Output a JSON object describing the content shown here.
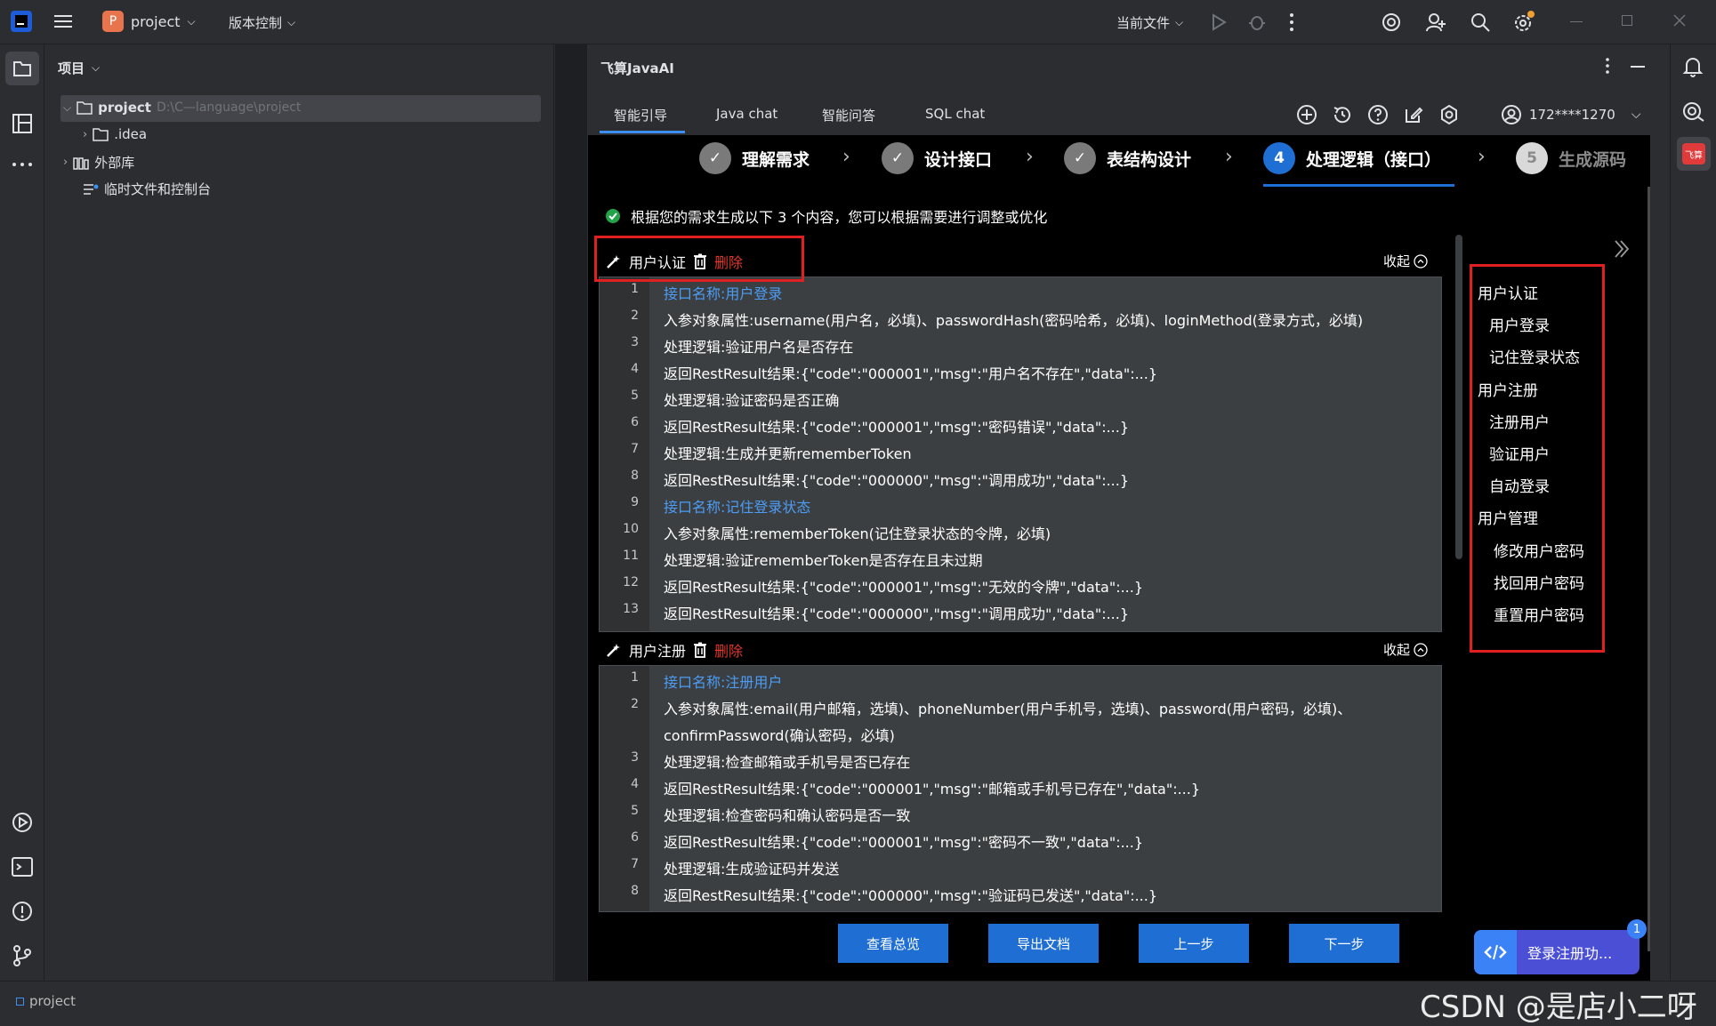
{
  "titlebar": {
    "project_badge": "P",
    "project_name": "project",
    "vcs_menu": "版本控制",
    "current_file": "当前文件"
  },
  "project_panel": {
    "title": "项目",
    "root_name": "project",
    "root_path": "D:\\C—language\\project",
    "items": [
      {
        "label": ".idea"
      },
      {
        "label": "外部库"
      },
      {
        "label": "临时文件和控制台"
      }
    ]
  },
  "plugin": {
    "title": "飞算JavaAI",
    "tabs": [
      "智能引导",
      "Java chat",
      "智能问答",
      "SQL chat"
    ],
    "active_tab": "智能引导",
    "account": "172****1270"
  },
  "steps": [
    {
      "label": "理解需求",
      "state": "done",
      "mark": "✓"
    },
    {
      "label": "设计接口",
      "state": "done",
      "mark": "✓"
    },
    {
      "label": "表结构设计",
      "state": "done",
      "mark": "✓"
    },
    {
      "label": "处理逻辑（接口）",
      "state": "active",
      "mark": "4"
    },
    {
      "label": "生成源码",
      "state": "pending",
      "mark": "5"
    }
  ],
  "info_message": "根据您的需求生成以下 3 个内容，您可以根据需要进行调整或优化",
  "sections": [
    {
      "name": "用户认证",
      "delete_label": "删除",
      "collapse_label": "收起",
      "lines": [
        {
          "n": "1",
          "text": "接口名称:用户登录",
          "type": "title"
        },
        {
          "n": "2",
          "text": "入参对象属性:username(用户名，必填)、passwordHash(密码哈希，必填)、loginMethod(登录方式，必填)",
          "type": "body"
        },
        {
          "n": "3",
          "text": "处理逻辑:验证用户名是否存在",
          "type": "body"
        },
        {
          "n": "4",
          "text": "返回RestResult结果:{\"code\":\"000001\",\"msg\":\"用户名不存在\",\"data\":...}",
          "type": "body"
        },
        {
          "n": "5",
          "text": "处理逻辑:验证密码是否正确",
          "type": "body"
        },
        {
          "n": "6",
          "text": "返回RestResult结果:{\"code\":\"000001\",\"msg\":\"密码错误\",\"data\":...}",
          "type": "body"
        },
        {
          "n": "7",
          "text": "处理逻辑:生成并更新rememberToken",
          "type": "body"
        },
        {
          "n": "8",
          "text": "返回RestResult结果:{\"code\":\"000000\",\"msg\":\"调用成功\",\"data\":...}",
          "type": "body"
        },
        {
          "n": "9",
          "text": "接口名称:记住登录状态",
          "type": "title"
        },
        {
          "n": "10",
          "text": "入参对象属性:rememberToken(记住登录状态的令牌，必填)",
          "type": "body"
        },
        {
          "n": "11",
          "text": "处理逻辑:验证rememberToken是否存在且未过期",
          "type": "body"
        },
        {
          "n": "12",
          "text": "返回RestResult结果:{\"code\":\"000001\",\"msg\":\"无效的令牌\",\"data\":...}",
          "type": "body"
        },
        {
          "n": "13",
          "text": "返回RestResult结果:{\"code\":\"000000\",\"msg\":\"调用成功\",\"data\":...}",
          "type": "body"
        }
      ]
    },
    {
      "name": "用户注册",
      "delete_label": "删除",
      "collapse_label": "收起",
      "lines": [
        {
          "n": "1",
          "text": "接口名称:注册用户",
          "type": "title"
        },
        {
          "n": "2",
          "text": "入参对象属性:email(用户邮箱，选填)、phoneNumber(用户手机号，选填)、password(用户密码，必填)、",
          "type": "body"
        },
        {
          "n": "",
          "text": "confirmPassword(确认密码，必填)",
          "type": "body"
        },
        {
          "n": "3",
          "text": "处理逻辑:检查邮箱或手机号是否已存在",
          "type": "body"
        },
        {
          "n": "4",
          "text": "返回RestResult结果:{\"code\":\"000001\",\"msg\":\"邮箱或手机号已存在\",\"data\":...}",
          "type": "body"
        },
        {
          "n": "5",
          "text": "处理逻辑:检查密码和确认密码是否一致",
          "type": "body"
        },
        {
          "n": "6",
          "text": "返回RestResult结果:{\"code\":\"000001\",\"msg\":\"密码不一致\",\"data\":...}",
          "type": "body"
        },
        {
          "n": "7",
          "text": "处理逻辑:生成验证码并发送",
          "type": "body"
        },
        {
          "n": "8",
          "text": "返回RestResult结果:{\"code\":\"000000\",\"msg\":\"验证码已发送\",\"data\":...}",
          "type": "body"
        }
      ]
    }
  ],
  "toc": [
    {
      "label": "用户认证",
      "level": 0
    },
    {
      "label": "用户登录",
      "level": 1
    },
    {
      "label": "记住登录状态",
      "level": 1
    },
    {
      "label": "用户注册",
      "level": 0
    },
    {
      "label": "注册用户",
      "level": 1
    },
    {
      "label": "验证用户",
      "level": 1
    },
    {
      "label": "自动登录",
      "level": 1
    },
    {
      "label": "用户管理",
      "level": 0
    },
    {
      "label": "修改用户密码",
      "level": 2
    },
    {
      "label": "找回用户密码",
      "level": 2
    },
    {
      "label": "重置用户密码",
      "level": 2
    }
  ],
  "buttons": {
    "overview": "查看总览",
    "export": "导出文档",
    "prev": "上一步",
    "next": "下一步"
  },
  "task_chip": {
    "label": "登录注册功...",
    "badge": "1"
  },
  "right_strip": {
    "plugin_badge": "飞算"
  },
  "statusbar": {
    "project": "project"
  },
  "watermark": "CSDN @是店小二呀",
  "colors": {
    "accent": "#1f6ed4",
    "link_blue": "#4c9cf5",
    "delete_red": "#e0392b",
    "annotation_red": "#e02020",
    "success_green": "#22a34a"
  }
}
